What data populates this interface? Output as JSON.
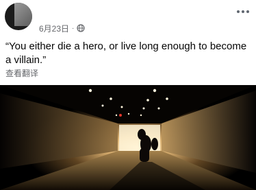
{
  "post": {
    "author_name": "",
    "date": "6月23日",
    "separator": "·",
    "privacy_icon": "globe-icon",
    "more_icon": "more-horizontal-icon",
    "text": "“You either die a hero, or live long enough to become a villain.”",
    "translate_label": "查看翻译",
    "image": {
      "subject": "motorcyclist riding through a lit tunnel"
    }
  },
  "colors": {
    "meta_gray": "#65676b",
    "text": "#050505",
    "background": "#ffffff"
  }
}
